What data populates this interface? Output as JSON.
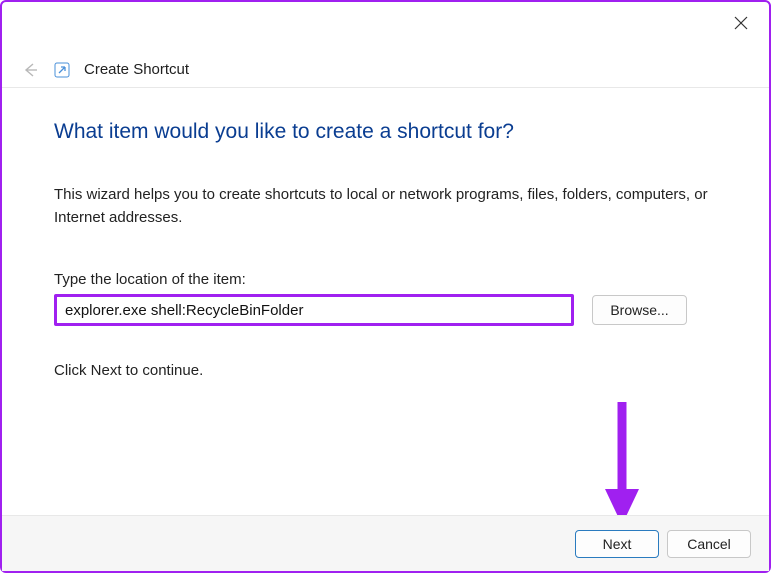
{
  "window": {
    "title": "Create Shortcut"
  },
  "content": {
    "heading": "What item would you like to create a shortcut for?",
    "description": "This wizard helps you to create shortcuts to local or network programs, files, folders, computers, or Internet addresses.",
    "field_label": "Type the location of the item:",
    "location_value": "explorer.exe shell:RecycleBinFolder",
    "browse_label": "Browse...",
    "continue_text": "Click Next to continue."
  },
  "footer": {
    "next_label": "Next",
    "cancel_label": "Cancel"
  },
  "colors": {
    "highlight": "#a020f0",
    "heading": "#0a3d91"
  }
}
